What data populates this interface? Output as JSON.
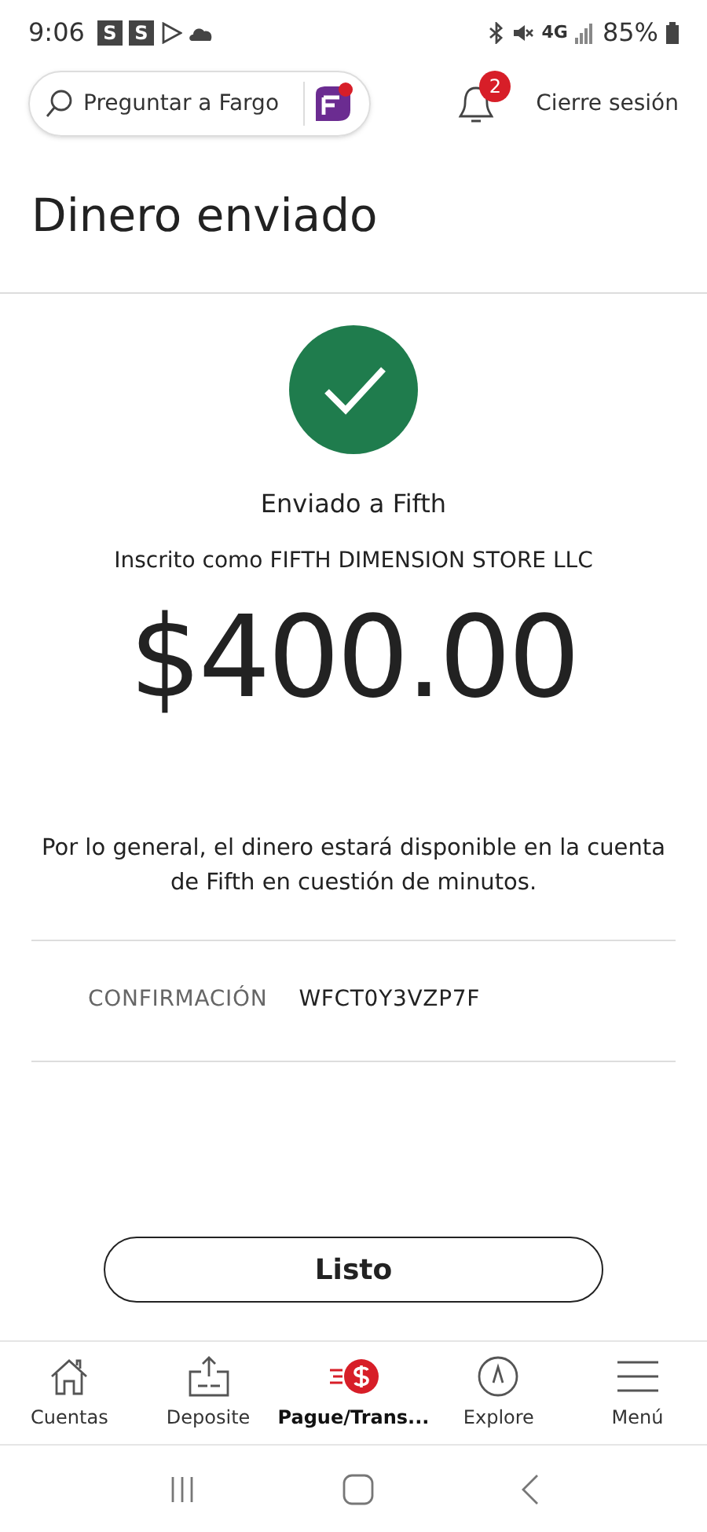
{
  "status_bar": {
    "time": "9:06",
    "notification_badges": [
      "S",
      "S"
    ],
    "network": "4G",
    "battery": "85%"
  },
  "header": {
    "search": {
      "placeholder": "Preguntar a Fargo"
    },
    "notifications_count": "2",
    "logout": "Cierre sesión"
  },
  "title": "Dinero enviado",
  "confirmation": {
    "sent_to": "Enviado a Fifth",
    "enrolled_as": "Inscrito como FIFTH DIMENSION STORE LLC",
    "amount": "$400.00",
    "note": "Por lo general, el dinero estará disponible en la cuenta de Fifth en cuestión de minutos.",
    "label": "CONFIRMACIÓN",
    "code": "WFCT0Y3VZP7F"
  },
  "done_button": "Listo",
  "bottom_nav": [
    {
      "kind": "home",
      "label": "Cuentas",
      "selected": false
    },
    {
      "kind": "deposit",
      "label": "Deposite",
      "selected": false
    },
    {
      "kind": "pay",
      "label": "Pague/Trans...",
      "selected": true
    },
    {
      "kind": "explore",
      "label": "Explore",
      "selected": false
    },
    {
      "kind": "menu",
      "label": "Menú",
      "selected": false
    }
  ]
}
